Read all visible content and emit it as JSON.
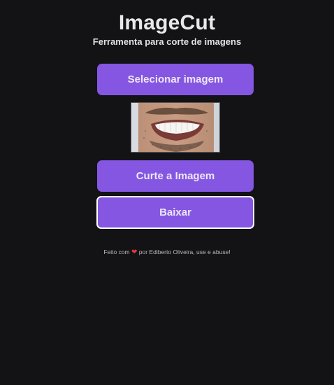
{
  "app": {
    "title": "ImageCut",
    "subtitle": "Ferramenta para corte de imagens"
  },
  "buttons": {
    "select_label": "Selecionar imagem",
    "cut_label": "Curte a Imagem",
    "download_label": "Baixar"
  },
  "preview": {
    "description_icon": "cropped-smile-photo"
  },
  "footer": {
    "prefix": "Feito com",
    "heart": "❤",
    "suffix": "por Ediberto Oliveira, use e abuse!"
  },
  "colors": {
    "background": "#131316",
    "accent": "#8456e2",
    "heart": "#e0363c"
  }
}
